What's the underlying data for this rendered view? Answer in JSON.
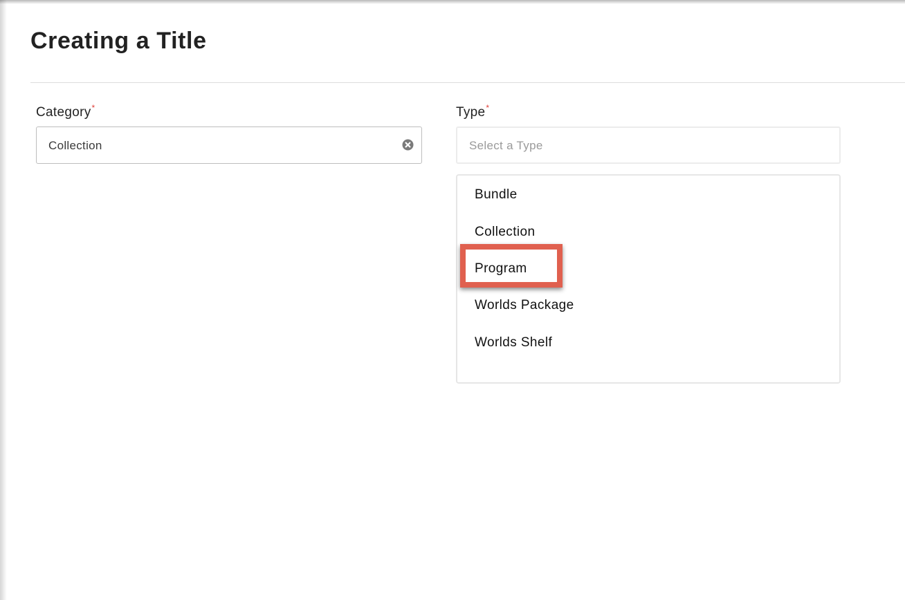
{
  "page": {
    "title": "Creating a Title"
  },
  "form": {
    "category": {
      "label": "Category",
      "required_mark": "*",
      "value": "Collection",
      "clear_icon": "clear-circle-icon"
    },
    "type": {
      "label": "Type",
      "required_mark": "*",
      "placeholder": "Select a Type",
      "options": [
        "Bundle",
        "Collection",
        "Program",
        "Worlds Package",
        "Worlds Shelf"
      ],
      "highlighted_option": "Program"
    }
  },
  "colors": {
    "required": "#e0413b",
    "highlight": "#e0604f",
    "placeholder": "#9a9a9a"
  }
}
